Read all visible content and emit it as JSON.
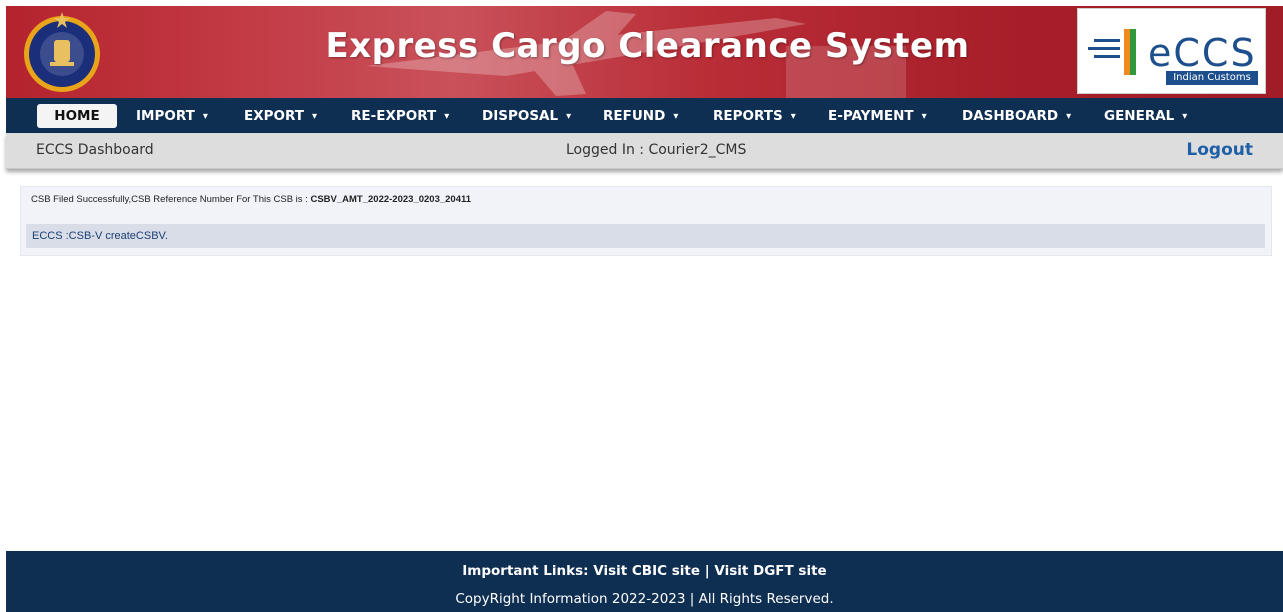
{
  "header": {
    "title": "Express Cargo Clearance System",
    "logo_text": "eCCS",
    "logo_subtitle": "Indian Customs",
    "colors": {
      "header_red": "#b4232d",
      "nav_navy": "#0e2e52",
      "logo_blue": "#1e4f8d"
    }
  },
  "nav": {
    "items": [
      {
        "label": "HOME",
        "caret": ""
      },
      {
        "label": "IMPORT",
        "caret": "▾"
      },
      {
        "label": "EXPORT",
        "caret": "▾"
      },
      {
        "label": "RE-EXPORT",
        "caret": "▾"
      },
      {
        "label": "DISPOSAL",
        "caret": "▾"
      },
      {
        "label": "REFUND",
        "caret": "▾"
      },
      {
        "label": "REPORTS",
        "caret": "▾"
      },
      {
        "label": "E-PAYMENT",
        "caret": "▾"
      },
      {
        "label": "DASHBOARD",
        "caret": "▾"
      },
      {
        "label": "GENERAL",
        "caret": "▾"
      }
    ]
  },
  "subbar": {
    "dashboard_label": "ECCS Dashboard",
    "logged_in": "Logged In : Courier2_CMS",
    "logout": "Logout"
  },
  "content": {
    "message_prefix": "CSB Filed Successfully,CSB Reference Number For This CSB is : ",
    "reference_number": "CSBV_AMT_2022-2023_0203_20411",
    "breadcrumb": "ECCS :CSB-V createCSBV."
  },
  "footer": {
    "links_prefix": "Important Links: ",
    "link_cbic": "Visit CBIC site",
    "separator": " | ",
    "link_dgft": "Visit DGFT site",
    "copyright": "CopyRight Information 2022-2023 | All Rights Reserved."
  }
}
